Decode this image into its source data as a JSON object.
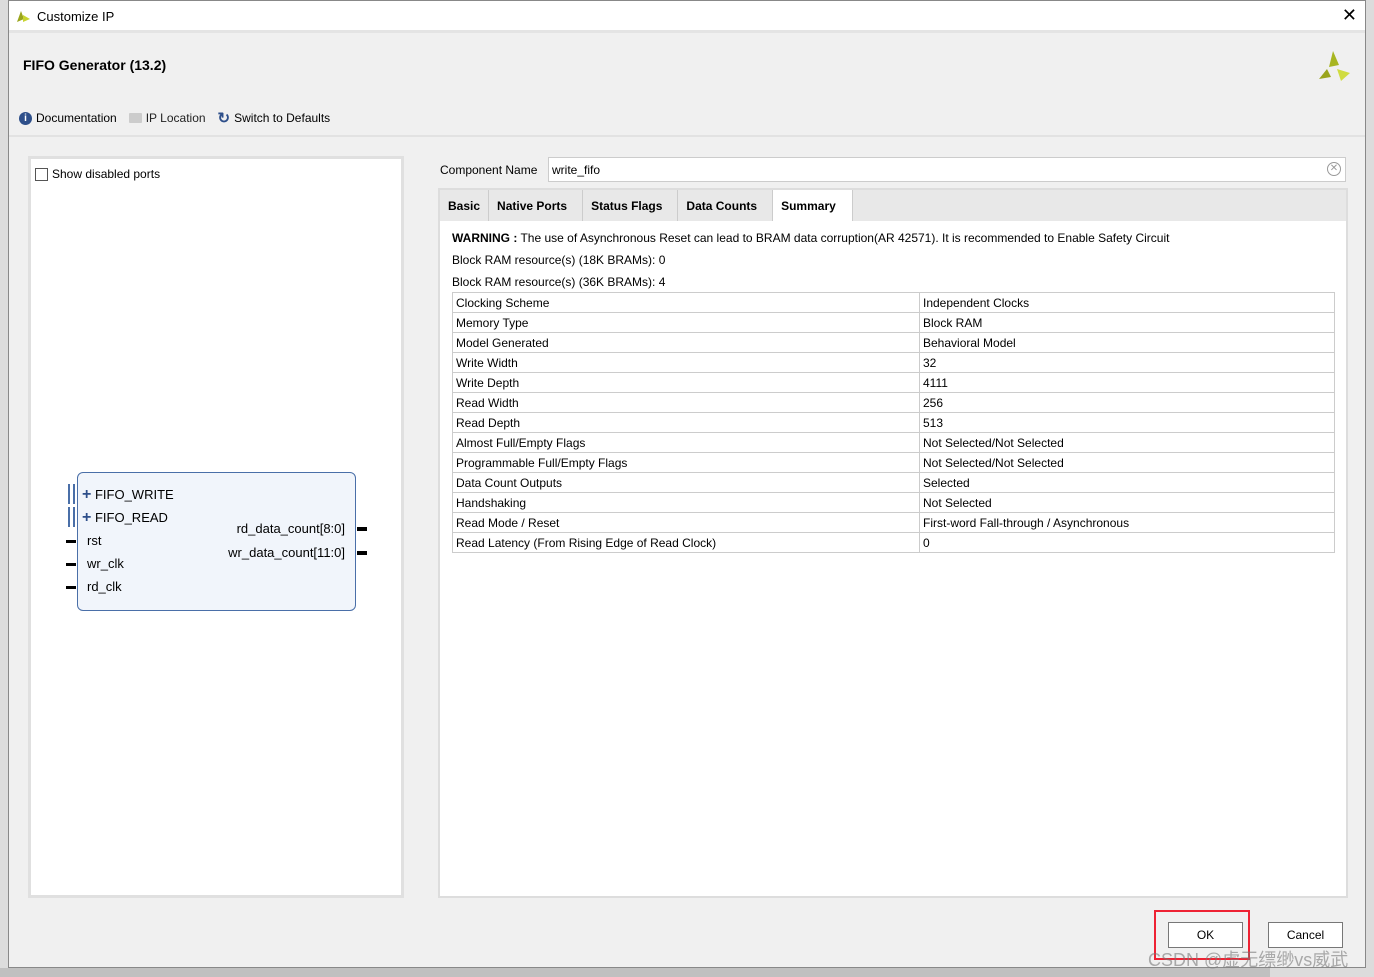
{
  "window": {
    "title": "Customize IP",
    "close": "✕"
  },
  "header": {
    "title": "FIFO Generator (13.2)"
  },
  "toolbar": {
    "documentation": "Documentation",
    "ip_location": "IP Location",
    "switch_defaults": "Switch to Defaults"
  },
  "left": {
    "show_disabled": "Show disabled ports",
    "symbol": {
      "bus_ports": [
        "FIFO_WRITE",
        "FIFO_READ"
      ],
      "inputs": [
        "rst",
        "wr_clk",
        "rd_clk"
      ],
      "outputs": [
        "rd_data_count[8:0]",
        "wr_data_count[11:0]"
      ]
    }
  },
  "component": {
    "label": "Component Name",
    "value": "write_fifo"
  },
  "tabs": [
    "Basic",
    "Native Ports",
    "Status Flags",
    "Data Counts",
    "Summary"
  ],
  "summary": {
    "warning_label": "WARNING :",
    "warning": " The use of Asynchronous Reset can lead to BRAM data corruption(AR 42571). It is recommended to Enable Safety Circuit",
    "bram18": "Block RAM resource(s) (18K BRAMs): 0",
    "bram36": "Block RAM resource(s) (36K BRAMs): 4",
    "rows": [
      [
        "Clocking Scheme",
        "Independent Clocks"
      ],
      [
        "Memory Type",
        "Block RAM"
      ],
      [
        "Model Generated",
        "Behavioral Model"
      ],
      [
        "Write Width",
        "32"
      ],
      [
        "Write Depth",
        "4111"
      ],
      [
        "Read Width",
        "256"
      ],
      [
        "Read Depth",
        "513"
      ],
      [
        "Almost Full/Empty Flags",
        "Not Selected/Not Selected"
      ],
      [
        "Programmable Full/Empty Flags",
        "Not Selected/Not Selected"
      ],
      [
        "Data Count Outputs",
        "Selected"
      ],
      [
        "Handshaking",
        "Not Selected"
      ],
      [
        "Read Mode / Reset",
        "First-word Fall-through / Asynchronous"
      ],
      [
        "Read Latency (From Rising Edge of Read Clock)",
        "0"
      ]
    ]
  },
  "buttons": {
    "ok": "OK",
    "cancel": "Cancel"
  },
  "watermark": "CSDN @虚无缥缈vs威武"
}
